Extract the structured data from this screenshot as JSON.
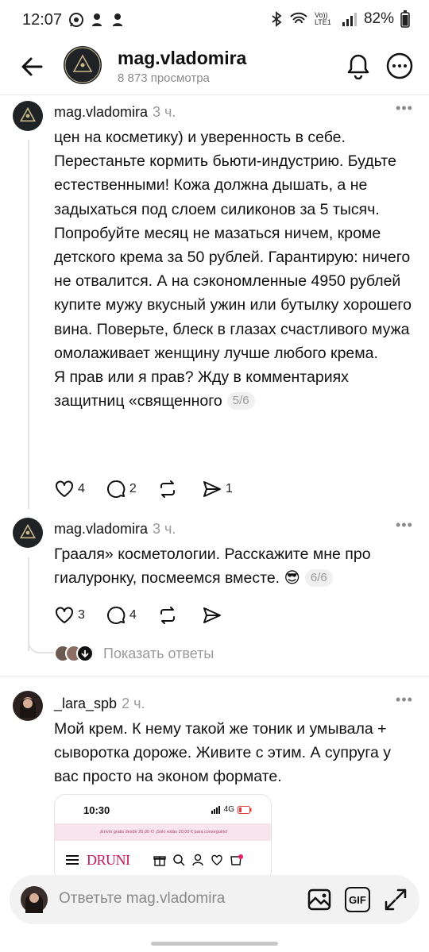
{
  "status_bar": {
    "time": "12:07",
    "network": "Vo)) LTE1",
    "battery": "82%"
  },
  "header": {
    "title": "mag.vladomira",
    "subtitle": "8 873 просмотра"
  },
  "comments": [
    {
      "user": "mag.vladomira",
      "time": "3 ч.",
      "paragraphs": [
        "цен на косметику) и уверенность в себе.",
        "Перестаньте кормить бьюти-индустрию. Будьте естественными! Кожа должна дышать, а не задыхаться под слоем силиконов за 5 тысяч.",
        "Попробуйте месяц не мазаться ничем, кроме детского крема за 50 рублей. Гарантирую: ничего не отвалится. А на сэкономленные 4950 рублей купите мужу вкусный ужин или бутылку хорошего вина. Поверьте, блеск в глазах счастливого мужа омолаживает женщину лучше любого крема.",
        "Я прав или я прав? Жду в комментариях защитниц «священного"
      ],
      "page": "5/6",
      "likes": "4",
      "replies": "2",
      "reposts": "",
      "shares": "1"
    },
    {
      "user": "mag.vladomira",
      "time": "3 ч.",
      "paragraphs": [
        "Грааля» косметологии. Расскажите мне про гиалуронку, посмеемся вместе. 😎"
      ],
      "page": "6/6",
      "likes": "3",
      "replies": "4",
      "reposts": "",
      "shares": ""
    },
    {
      "user": "_lara_spb",
      "time": "2 ч.",
      "paragraphs": [
        "Мой крем. К нему такой же тоник и умывала + сыворотка дороже. Живите с этим. А супруга у вас просто на эконом формате."
      ]
    }
  ],
  "show_replies": "Показать ответы",
  "embed": {
    "time": "10:30",
    "network": "4G",
    "banner": "¡Envío gratis desde 20,00 €! ¡Solo estás 20,00 € para conseguirlo!",
    "brand": "DRUNI"
  },
  "composer": {
    "placeholder": "Ответьте mag.vladomira",
    "gif": "GIF"
  },
  "colors": {
    "accent": "#e8a6c0",
    "brand": "#c2185b",
    "muted": "#9a9a9a"
  }
}
